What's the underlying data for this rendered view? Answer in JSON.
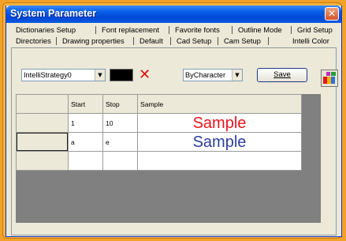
{
  "window": {
    "title": "System Parameter",
    "close_glyph": "✕"
  },
  "tabs": {
    "row1": [
      "Dictionaries Setup",
      "Font replacement",
      "Favorite fonts",
      "Outline Mode",
      "Grid Setup"
    ],
    "row2": [
      "Directories",
      "Drawing properties",
      "Default",
      "Cad Setup",
      "Cam Setup",
      "Intelli Color"
    ],
    "active": "Intelli Color"
  },
  "toolbar": {
    "strategy_value": "IntelliStrategy0",
    "color_swatch": "#000000",
    "delete_icon": "red-x-icon",
    "mode_value": "ByCharacter",
    "save_label": "Save",
    "palette_icon": "color-palette-icon"
  },
  "grid": {
    "columns": [
      "Start",
      "Stop",
      "Sample"
    ],
    "rows": [
      {
        "start": "1",
        "stop": "10",
        "sample": "Sample",
        "color": "#e8141b"
      },
      {
        "start": "a",
        "stop": "e",
        "sample": "Sample",
        "color": "#2e3e9c"
      },
      {
        "start": "",
        "stop": "",
        "sample": "",
        "color": ""
      }
    ]
  }
}
